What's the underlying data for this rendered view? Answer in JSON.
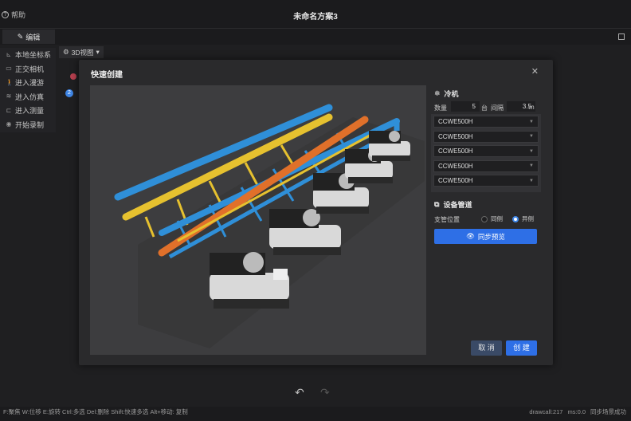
{
  "app": {
    "title": "未命名方案3",
    "help_label": "帮助"
  },
  "tabs": {
    "edit_label": "编辑"
  },
  "side_menu": [
    {
      "label": "本地坐标系",
      "icon": "axis-icon"
    },
    {
      "label": "正交相机",
      "icon": "camera-icon"
    },
    {
      "label": "进入漫游",
      "icon": "walk-icon"
    },
    {
      "label": "进入仿真",
      "icon": "simulation-icon"
    },
    {
      "label": "进入测量",
      "icon": "ruler-icon"
    },
    {
      "label": "开始录制",
      "icon": "record-icon"
    }
  ],
  "view": {
    "label": "3D视图"
  },
  "dialog": {
    "title": "快速创建",
    "chiller": {
      "section_title": "冷机",
      "count_label": "数量",
      "count_value": "5",
      "count_unit": "台",
      "spacing_label": "间隔",
      "spacing_value": "3.5",
      "spacing_unit": "m",
      "models": [
        "CCWE500H",
        "CCWE500H",
        "CCWE500H",
        "CCWE500H",
        "CCWE500H"
      ]
    },
    "pipes": {
      "section_title": "设备管道",
      "branch_label": "支管位置",
      "option_same": "同侧",
      "option_opposite": "异侧",
      "selected": "异侧"
    },
    "sync_label": "同步预览",
    "cancel_label": "取 消",
    "create_label": "创 建"
  },
  "status": {
    "shortcuts": "F:聚焦  W:位移  E:旋转  Ctrl:多选  Del:删除  Shift:快速多选  Alt+移动: 复制",
    "drawcall": "drawcall:217",
    "ms": "ms:0.0",
    "sync_msg": "同步场景成功"
  },
  "colors": {
    "accent": "#2e6fe6",
    "pipe_blue": "#2f8fd8",
    "pipe_yellow": "#e6c12f",
    "pipe_orange": "#e0702a"
  }
}
